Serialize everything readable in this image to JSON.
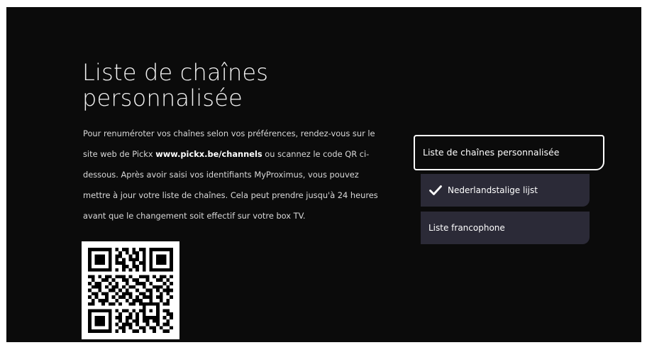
{
  "page": {
    "title_line1": "Liste de chaînes",
    "title_line2": "personnalisée",
    "description": {
      "part1": "Pour renuméroter vos chaînes selon vos préférences, rendez-vous sur le site web de Pickx ",
      "link": "www.pickx.be/channels",
      "part2": " ou scannez le code QR ci-dessous. Après avoir saisi vos identifiants MyProximus, vous pouvez mettre à jour votre liste de chaînes. Cela peut prendre jusqu'à 24 heures avant que le changement soit effectif sur votre box TV."
    }
  },
  "channel_list": {
    "header_label": "Liste de chaînes personnalisée",
    "options": [
      {
        "label": "Nederlandstalige lijst",
        "selected": true,
        "icon": "checkmark-icon"
      },
      {
        "label": "Liste francophone",
        "selected": false
      }
    ]
  },
  "qr_code": {
    "icon": "qr-code-icon"
  },
  "colors": {
    "background": "#0b0b0b",
    "option_background": "#2b2a37",
    "text": "#ffffff",
    "focus_border": "#ffffff"
  }
}
